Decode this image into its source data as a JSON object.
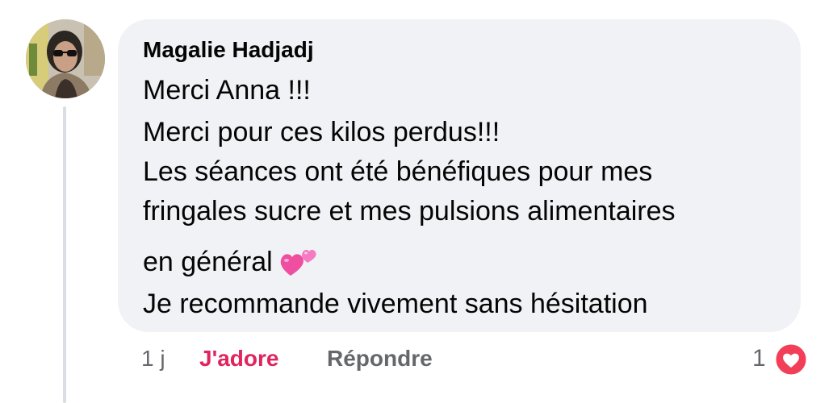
{
  "comment": {
    "author": "Magalie Hadjadj",
    "lines": [
      "Merci Anna !!!",
      "Merci pour ces kilos perdus!!!",
      "Les séances ont été bénéfiques pour mes",
      "fringales sucre et mes pulsions alimentaires",
      "en général",
      "Je recommande vivement sans hésitation"
    ],
    "emoji_icon": "two-hearts-icon"
  },
  "actions": {
    "time": "1 j",
    "love_label": "J'adore",
    "reply_label": "Répondre"
  },
  "reactions": {
    "count": "1",
    "icon": "love-reaction-icon",
    "color": "#f33e58"
  },
  "colors": {
    "bubble": "#f0f2f5",
    "love_accent": "#e0245e",
    "secondary_text": "#65676b"
  }
}
